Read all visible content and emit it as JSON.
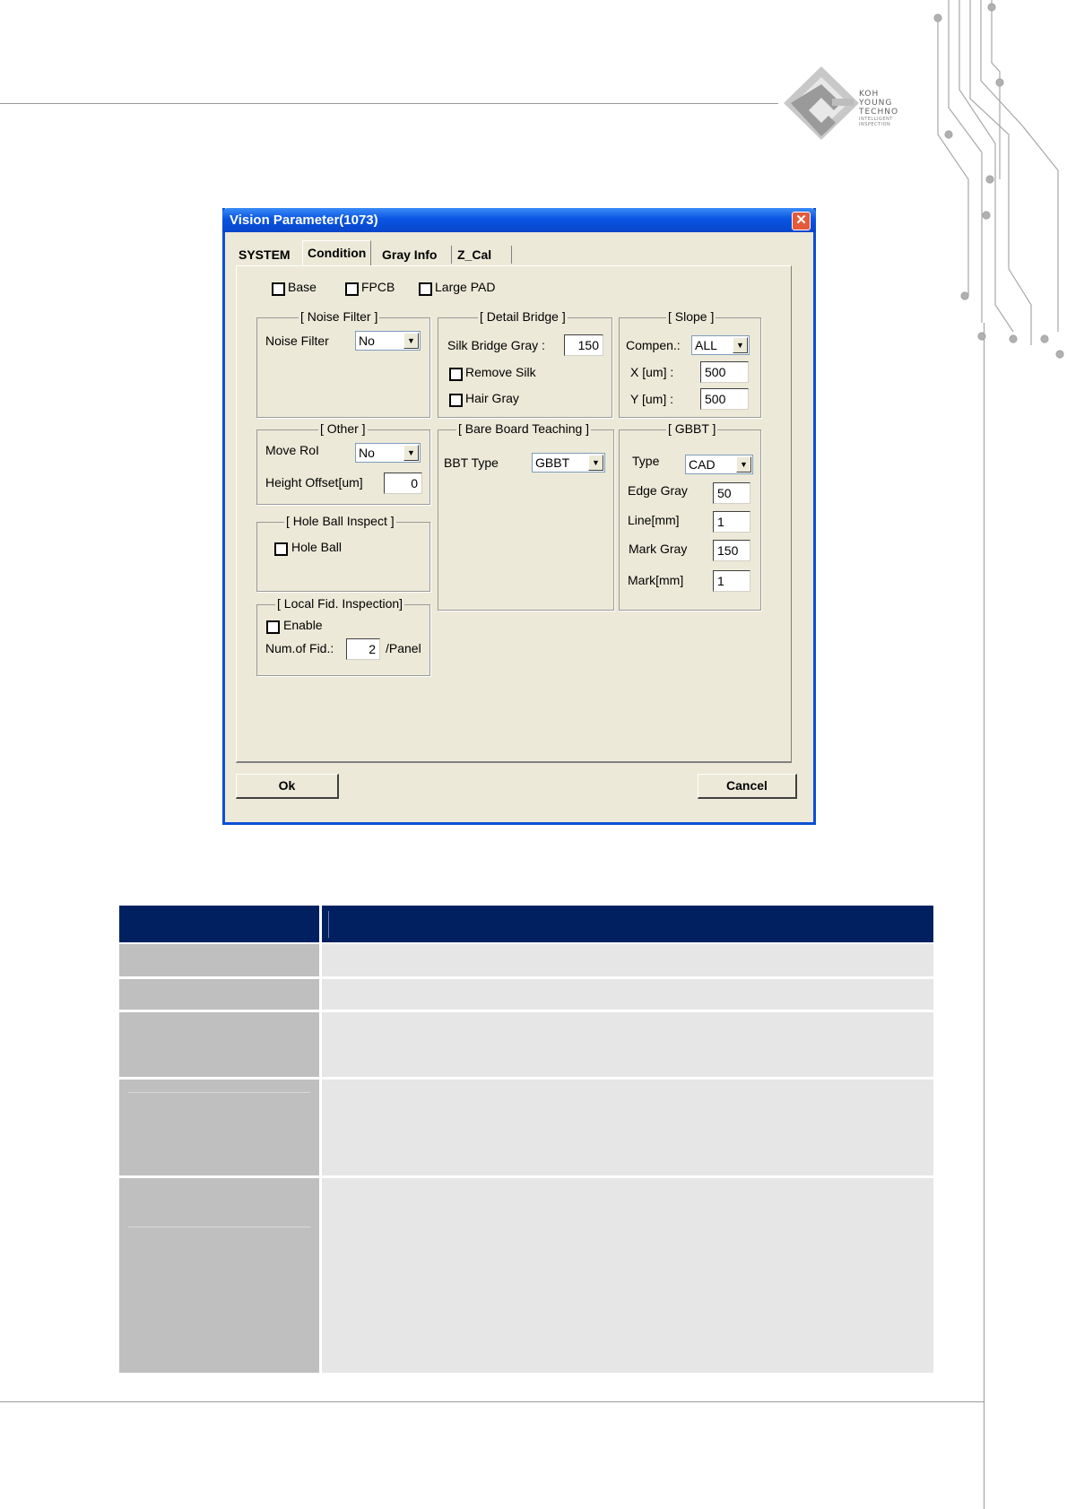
{
  "brand": {
    "name_lines": [
      "KOH",
      "YOUNG",
      "TECHNO"
    ],
    "tagline_lines": [
      "INTELLIGENT",
      "INSPECTION"
    ]
  },
  "dialog": {
    "title": "Vision Parameter(1073)",
    "close_glyph": "✕",
    "tabs": [
      "SYSTEM",
      "Condition",
      "Gray Info",
      "Z_Cal"
    ],
    "active_tab": "Condition",
    "top_checkboxes": [
      "Base",
      "FPCB",
      "Large PAD"
    ],
    "noise_filter": {
      "title": "[ Noise Filter ]",
      "label": "Noise Filter",
      "value": "No"
    },
    "detail_bridge": {
      "title": "[ Detail Bridge ]",
      "silk_bridge_gray_label": "Silk Bridge Gray :",
      "silk_bridge_gray_value": "150",
      "remove_silk_label": "Remove Silk",
      "hair_gray_label": "Hair Gray"
    },
    "slope": {
      "title": "[ Slope ]",
      "compen_label": "Compen.:",
      "compen_value": "ALL",
      "x_label": "X [um] :",
      "x_value": "500",
      "y_label": "Y [um] :",
      "y_value": "500"
    },
    "other": {
      "title": "[ Other ]",
      "move_roi_label": "Move RoI",
      "move_roi_value": "No",
      "height_offset_label": "Height Offset[um]",
      "height_offset_value": "0"
    },
    "bare_board": {
      "title": "[ Bare Board Teaching ]",
      "bbt_type_label": "BBT Type",
      "bbt_type_value": "GBBT"
    },
    "gbbt": {
      "title": "[ GBBT ]",
      "type_label": "Type",
      "type_value": "CAD",
      "edge_gray_label": "Edge Gray",
      "edge_gray_value": "50",
      "line_label": "Line[mm]",
      "line_value": "1",
      "mark_gray_label": "Mark Gray",
      "mark_gray_value": "150",
      "mark_label": "Mark[mm]",
      "mark_value": "1"
    },
    "hole_ball": {
      "title": "[ Hole Ball Inspect ]",
      "checkbox_label": "Hole Ball"
    },
    "local_fid": {
      "title": "[ Local Fid. Inspection]",
      "enable_label": "Enable",
      "num_label": "Num.of Fid.:",
      "num_value": "2",
      "unit": "/Panel"
    },
    "ok_label": "Ok",
    "cancel_label": "Cancel"
  },
  "colors": {
    "table_header": "#002060",
    "table_label_bg": "#bfbfbf",
    "table_value_bg": "#e6e6e6",
    "dialog_bg": "#ece9d8",
    "titlebar": "#0a55e3"
  }
}
